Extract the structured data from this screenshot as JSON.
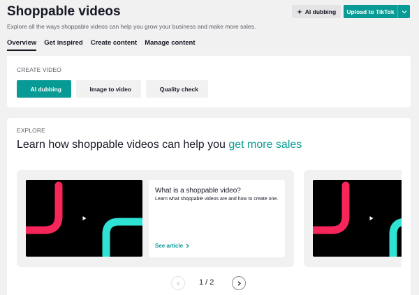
{
  "header": {
    "title": "Shoppable videos",
    "subtitle": "Explore all the ways shoppable videos can help you grow your business and make more sales.",
    "ai_dubbing_label": "AI dubbing",
    "upload_label": "Upload to TikTok"
  },
  "tabs": [
    {
      "label": "Overview",
      "active": true
    },
    {
      "label": "Get inspired",
      "active": false
    },
    {
      "label": "Create content",
      "active": false
    },
    {
      "label": "Manage content",
      "active": false
    }
  ],
  "create_video": {
    "section_label": "CREATE VIDEO",
    "buttons": [
      {
        "label": "AI dubbing",
        "icon": "sparkle-icon"
      },
      {
        "label": "Image to video",
        "icon": "flask-icon"
      },
      {
        "label": "Quality check",
        "icon": "shield-check-icon"
      }
    ]
  },
  "explore": {
    "section_label": "EXPLORE",
    "heading_prefix": "Learn how shoppable videos can help you ",
    "heading_accent": "get more sales",
    "article": {
      "title": "What is a shoppable video?",
      "description": "Learn what shoppable videos are and how to create one.",
      "link_label": "See article"
    },
    "pager": {
      "current": 1,
      "total": 2,
      "text": "1 / 2"
    }
  },
  "colors": {
    "accent": "#089a94",
    "background": "#f1f1f2",
    "pink_stroke": "#f6265a",
    "cyan_stroke": "#2fe3d4"
  }
}
